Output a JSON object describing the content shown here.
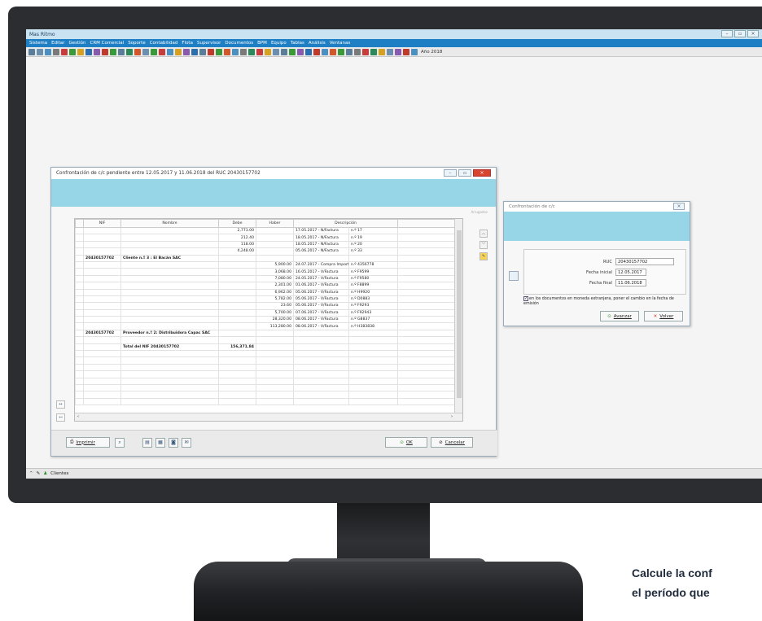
{
  "app": {
    "title": "Mas Ritmo",
    "menu": [
      "Sistema",
      "Editar",
      "Gestión",
      "CRM Comercial",
      "Soporte",
      "Contabilidad",
      "Flota",
      "Supervisor",
      "Documentos",
      "BPM",
      "Equipo",
      "Tablas",
      "Análisis",
      "Ventanas"
    ],
    "year_label": "Año 2018",
    "status_tab": "Clientes"
  },
  "main_dialog": {
    "title": "Confrontación de c/c pendiente entre 12.05.2017 y 11.06.2018 del RUC 20430157702",
    "hint": "Arrugados",
    "columns": [
      "NIF",
      "Nombre",
      "Debe",
      "Haber",
      "Descripción"
    ],
    "rows": [
      {
        "nif": "",
        "nombre": "",
        "debe": "2,773.00",
        "haber": "",
        "desc": "17.05.2017 - N/Factura",
        "ref": "n.º 17",
        "bold": false
      },
      {
        "nif": "",
        "nombre": "",
        "debe": "212.40",
        "haber": "",
        "desc": "18.05.2017 - N/Factura",
        "ref": "n.º 19",
        "bold": false
      },
      {
        "nif": "",
        "nombre": "",
        "debe": "118.00",
        "haber": "",
        "desc": "18.05.2017 - N/Factura",
        "ref": "n.º 20",
        "bold": false
      },
      {
        "nif": "",
        "nombre": "",
        "debe": "4,248.00",
        "haber": "",
        "desc": "05.06.2017 - N/Factura",
        "ref": "n.º 33",
        "bold": false
      },
      {
        "nif": "20430157702",
        "nombre": "Cliente n.º      3     : El Bacán SAC",
        "debe": "",
        "haber": "",
        "desc": "",
        "ref": "",
        "bold": true
      },
      {
        "nif": "",
        "nombre": "",
        "debe": "",
        "haber": "5,900.00",
        "desc": "24.07.2017 - Compra Importación",
        "ref": "n.º 4356778",
        "bold": false
      },
      {
        "nif": "",
        "nombre": "",
        "debe": "",
        "haber": "3,068.00",
        "desc": "16.05.2017 - V/Factura",
        "ref": "n.º F9599",
        "bold": false
      },
      {
        "nif": "",
        "nombre": "",
        "debe": "",
        "haber": "7,080.00",
        "desc": "24.05.2017 - V/Factura",
        "ref": "n.º F9580",
        "bold": false
      },
      {
        "nif": "",
        "nombre": "",
        "debe": "",
        "haber": "2,301.00",
        "desc": "01.06.2017 - V/Factura",
        "ref": "n.º F8899",
        "bold": false
      },
      {
        "nif": "",
        "nombre": "",
        "debe": "",
        "haber": "6,962.00",
        "desc": "05.06.2017 - V/Factura",
        "ref": "n.º H9920",
        "bold": false
      },
      {
        "nif": "",
        "nombre": "",
        "debe": "",
        "haber": "5,782.00",
        "desc": "05.06.2017 - V/Factura",
        "ref": "n.º D0883",
        "bold": false
      },
      {
        "nif": "",
        "nombre": "",
        "debe": "",
        "haber": "23.60",
        "desc": "05.06.2017 - V/Factura",
        "ref": "n.º F9293",
        "bold": false
      },
      {
        "nif": "",
        "nombre": "",
        "debe": "",
        "haber": "5,700.00",
        "desc": "07.06.2017 - V/Factura",
        "ref": "n.º F92943",
        "bold": false
      },
      {
        "nif": "",
        "nombre": "",
        "debe": "",
        "haber": "28,320.00",
        "desc": "08.06.2017 - V/Factura",
        "ref": "n.º G8837",
        "bold": false
      },
      {
        "nif": "",
        "nombre": "",
        "debe": "",
        "haber": "113,280.00",
        "desc": "08.06.2017 - V/Factura",
        "ref": "n.º H383838",
        "bold": false
      },
      {
        "nif": "20430157702",
        "nombre": "Proveedor n.º     2: Distribuidora Capac SAC",
        "debe": "",
        "haber": "",
        "desc": "",
        "ref": "",
        "bold": true
      },
      {
        "nif": "",
        "nombre": "",
        "debe": "",
        "haber": "",
        "desc": "",
        "ref": "",
        "bold": false
      },
      {
        "nif": "",
        "nombre": "Total del NIF  20430157702",
        "debe": "156,371.84",
        "haber": "",
        "desc": "",
        "ref": "",
        "bold": true
      },
      {
        "nif": "",
        "nombre": "",
        "debe": "",
        "haber": "",
        "desc": "",
        "ref": "",
        "bold": false
      },
      {
        "nif": "",
        "nombre": "",
        "debe": "",
        "haber": "",
        "desc": "",
        "ref": "",
        "bold": false
      },
      {
        "nif": "",
        "nombre": "",
        "debe": "",
        "haber": "",
        "desc": "",
        "ref": "",
        "bold": false
      },
      {
        "nif": "",
        "nombre": "",
        "debe": "",
        "haber": "",
        "desc": "",
        "ref": "",
        "bold": false
      },
      {
        "nif": "",
        "nombre": "",
        "debe": "",
        "haber": "",
        "desc": "",
        "ref": "",
        "bold": false
      },
      {
        "nif": "",
        "nombre": "",
        "debe": "",
        "haber": "",
        "desc": "",
        "ref": "",
        "bold": false
      },
      {
        "nif": "",
        "nombre": "",
        "debe": "",
        "haber": "",
        "desc": "",
        "ref": "",
        "bold": false
      },
      {
        "nif": "",
        "nombre": "",
        "debe": "",
        "haber": "",
        "desc": "",
        "ref": "",
        "bold": false
      }
    ],
    "print_label": "Imprimir",
    "ok_label": "OK",
    "cancel_label": "Cancelar"
  },
  "side_dialog": {
    "title": "Confrontación de c/c",
    "ruc_label": "RUC",
    "ruc_value": "20430157702",
    "start_label": "Fecha inicial",
    "start_value": "12.05.2017",
    "end_label": "Fecha final",
    "end_value": "11.06.2018",
    "checkbox_text": "en los documentos en moneda extranjera, poner el cambio en la fecha de emisión",
    "advance_label": "Avanzar",
    "back_label": "Volver"
  },
  "caption": {
    "line1": "Calcule la conf",
    "line2": "el período que"
  },
  "colors": {
    "menubar": "#1f7fc4",
    "dialog_band": "#97d6e6",
    "close_button": "#d9442e"
  }
}
